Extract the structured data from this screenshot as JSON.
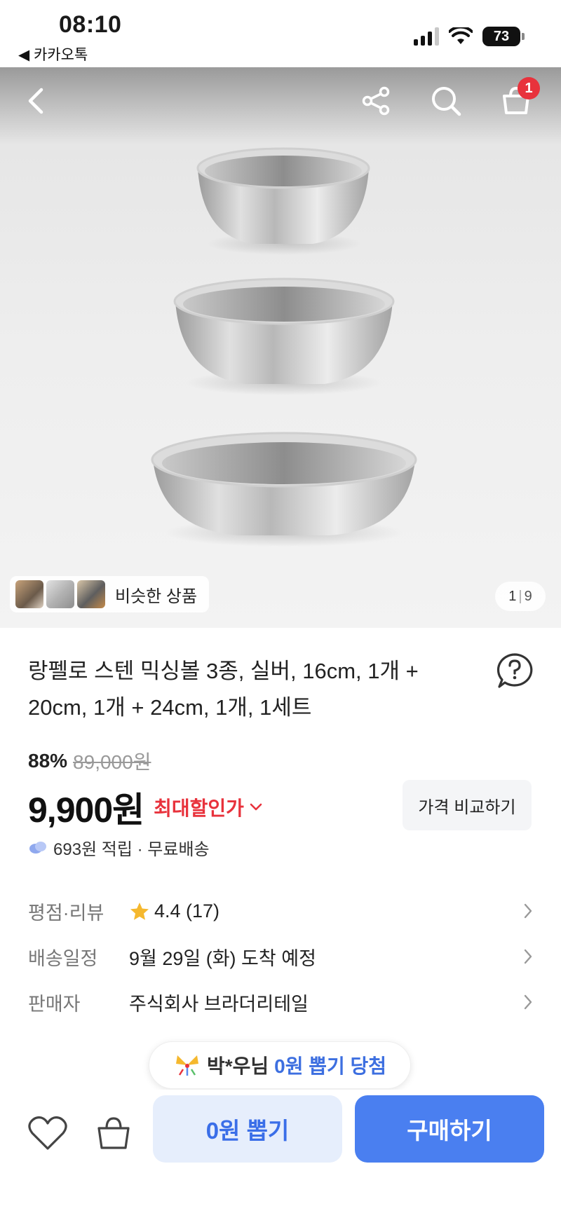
{
  "status_bar": {
    "time": "08:10",
    "back_app": "◀ 카카오톡",
    "battery": "73",
    "icons": [
      "signal-icon",
      "wifi-icon",
      "battery-icon"
    ]
  },
  "hero": {
    "nav_icons": [
      "back-icon",
      "share-icon",
      "search-icon",
      "cart-icon"
    ],
    "cart_count": "1",
    "image_subject": "three stainless mixing bowls",
    "similar_label": "비슷한 상품",
    "page_current": "1",
    "page_total": "9"
  },
  "product": {
    "title": "랑펠로 스텐 믹싱볼 3종, 실버, 16cm, 1개 + 20cm, 1개 + 24cm, 1개, 1세트",
    "discount_pct": "88%",
    "original_price": "89,000원",
    "price": "9,900원",
    "max_discount_label": "최대할인가",
    "compare_label": "가격 비교하기",
    "reward": "693원 적립 · 무료배송"
  },
  "info_rows": [
    {
      "label": "평점·리뷰",
      "value": "4.4 (17)"
    },
    {
      "label": "배송일정",
      "value": "9월 29일 (화) 도착 예정"
    },
    {
      "label": "판매자",
      "value": "주식회사 브라더리테일"
    }
  ],
  "winner": {
    "name": "박*우님",
    "message": "0원 뽑기 당첨"
  },
  "bottom_bar": {
    "draw_label": "0원 뽑기",
    "buy_label": "구매하기"
  },
  "colors": {
    "accent_red": "#e8323c",
    "accent_blue": "#4a7ff0",
    "draw_bg": "#e6eefc",
    "star": "#f5b82e"
  }
}
